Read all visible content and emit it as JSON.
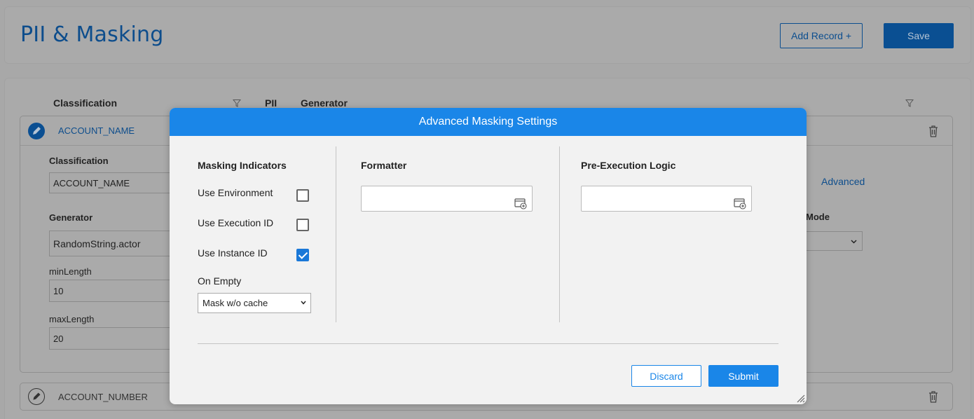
{
  "page": {
    "title": "PII & Masking",
    "add_record_label": "Add Record +",
    "save_label": "Save"
  },
  "table": {
    "columns": [
      "Classification",
      "PII",
      "Generator"
    ],
    "rows": [
      {
        "classification": "ACCOUNT_NAME",
        "expanded": true,
        "fields": {
          "classification_label": "Classification",
          "classification_value": "ACCOUNT_NAME",
          "generator_label": "Generator",
          "generator_value": "RandomString.actor",
          "min_length_label": "minLength",
          "min_length_value": "10",
          "max_length_label": "maxLength",
          "max_length_value": "20",
          "advanced_link": "Advanced",
          "mode_label": "Mode"
        }
      },
      {
        "classification": "ACCOUNT_NUMBER",
        "expanded": false
      }
    ]
  },
  "modal": {
    "title": "Advanced Masking Settings",
    "masking_indicators": {
      "title": "Masking Indicators",
      "options": [
        {
          "label": "Use Environment",
          "checked": false
        },
        {
          "label": "Use Execution ID",
          "checked": false
        },
        {
          "label": "Use Instance ID",
          "checked": true
        }
      ],
      "on_empty_label": "On Empty",
      "on_empty_value": "Mask w/o cache"
    },
    "formatter": {
      "title": "Formatter",
      "value": ""
    },
    "pre_execution": {
      "title": "Pre-Execution Logic",
      "value": ""
    },
    "discard_label": "Discard",
    "submit_label": "Submit"
  },
  "colors": {
    "accent": "#1a86e8",
    "overlay": "#a8a8a8",
    "modal_bg": "#f2f2f2"
  }
}
